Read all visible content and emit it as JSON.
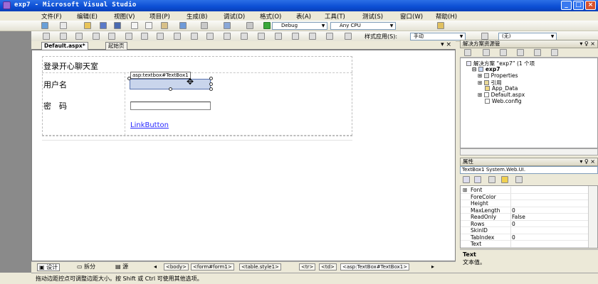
{
  "window": {
    "title": "exp7 - Microsoft Visual Studio",
    "controls": {
      "minimize": "_",
      "maximize": "□",
      "close": "×"
    }
  },
  "menu": [
    "文件(F)",
    "编辑(E)",
    "视图(V)",
    "项目(P)",
    "生成(B)",
    "调试(D)",
    "格式(O)",
    "表(A)",
    "工具(T)",
    "测试(S)",
    "窗口(W)",
    "帮助(H)"
  ],
  "toolbar": {
    "config": "Debug",
    "platform": "Any CPU",
    "style_label": "样式应用(S):",
    "style_value": "手动",
    "target_value": "(无)"
  },
  "tabs": [
    {
      "label": "Default.aspx*",
      "active": true
    },
    {
      "label": "起始页",
      "active": false
    }
  ],
  "tab_close": "▾ ×",
  "designer": {
    "heading": "登录开心聊天室",
    "user_label": "用户名",
    "password_label": "密　码",
    "selected_tag": "asp:textbox#TextBox1",
    "link_text": "LinkButton"
  },
  "viewbar": {
    "design": "设计",
    "split": "拆分",
    "source": "源",
    "breadcrumbs": [
      "<body>",
      "<form#form1>",
      "<table.style1>",
      "<tr>",
      "<td>",
      "<asp:TextBox#TextBox1>"
    ]
  },
  "status": "拖动边距控点可调整边距大小。按 Shift 或 Ctrl 可使用其他选项。",
  "solution_explorer": {
    "title": "解决方案资源管",
    "pin": "▾ ♀ ×",
    "root": "解决方案 “exp7” (1 个项",
    "project": "exp7",
    "items": [
      "Properties",
      "引用",
      "App_Data",
      "Default.aspx",
      "Web.config"
    ]
  },
  "properties": {
    "title": "属性",
    "pin": "▾ ♀ ×",
    "object": "TextBox1 System.Web.UI.",
    "rows": [
      {
        "name": "Font",
        "value": ""
      },
      {
        "name": "ForeColor",
        "value": ""
      },
      {
        "name": "Height",
        "value": ""
      },
      {
        "name": "MaxLength",
        "value": "0"
      },
      {
        "name": "ReadOnly",
        "value": "False"
      },
      {
        "name": "Rows",
        "value": "0"
      },
      {
        "name": "SkinID",
        "value": ""
      },
      {
        "name": "TabIndex",
        "value": "0"
      },
      {
        "name": "Text",
        "value": ""
      }
    ],
    "description_title": "Text",
    "description_text": "文本值。"
  },
  "colors": {
    "titlebar": "#0b4ed4",
    "chrome": "#ece9d8",
    "link": "#2a2aff",
    "selection": "#c9d5ec"
  }
}
